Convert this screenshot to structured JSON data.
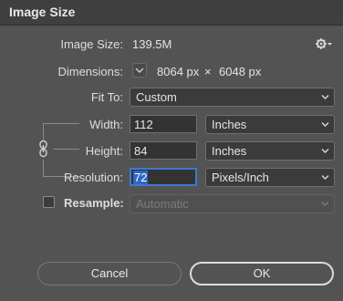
{
  "window": {
    "title": "Image Size"
  },
  "image_size": {
    "label": "Image Size:",
    "value": "139.5M"
  },
  "dimensions": {
    "label": "Dimensions:",
    "width": "8064 px",
    "times": "×",
    "height": "6048 px"
  },
  "fit_to": {
    "label": "Fit To:",
    "value": "Custom"
  },
  "width": {
    "label": "Width:",
    "value": "112",
    "unit": "Inches"
  },
  "height": {
    "label": "Height:",
    "value": "84",
    "unit": "Inches"
  },
  "resolution": {
    "label": "Resolution:",
    "value": "72",
    "unit": "Pixels/Inch"
  },
  "resample": {
    "label": "Resample:",
    "value": "Automatic",
    "checked": false
  },
  "buttons": {
    "cancel": "Cancel",
    "ok": "OK"
  },
  "icons": {
    "settings": "gear-icon",
    "dimensions_toggle": "chevron-down-icon",
    "constrain": "link-icon"
  }
}
